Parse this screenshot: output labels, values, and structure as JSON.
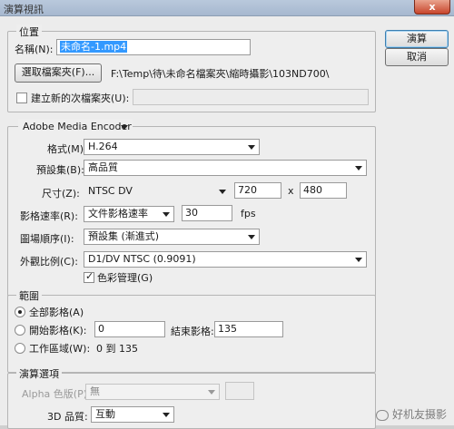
{
  "window": {
    "title": "演算視訊",
    "close_glyph": "x"
  },
  "buttons": {
    "render": "演算",
    "cancel": "取消"
  },
  "location": {
    "legend": "位置",
    "name_label": "名稱(N):",
    "name_value": "未命名-1.mp4",
    "select_folder": "選取檔案夾(F)...",
    "folder_path": "F:\\Temp\\待\\未命名檔案夾\\縮時攝影\\103ND700\\",
    "create_subfolder": "建立新的次檔案夾(U):",
    "subfolder_value": ""
  },
  "encoder": {
    "selector": "Adobe Media Encoder",
    "format_label": "格式(M):",
    "format_value": "H.264",
    "preset_label": "預設集(B):",
    "preset_value": "高品質",
    "size_label": "尺寸(Z):",
    "size_value": "NTSC DV",
    "width": "720",
    "x": "x",
    "height": "480",
    "framerate_label": "影格速率(R):",
    "framerate_value": "文件影格速率",
    "fps_value": "30",
    "fps_unit": "fps",
    "field_order_label": "圖場順序(I):",
    "field_order_value": "預設集 (漸進式)",
    "aspect_label": "外觀比例(C):",
    "aspect_value": "D1/DV NTSC (0.9091)",
    "color_mgmt": "色彩管理(G)"
  },
  "range": {
    "legend": "範圍",
    "all_frames": "全部影格(A)",
    "start_frame": "開始影格(K):",
    "start_value": "0",
    "end_label": "結束影格:",
    "end_value": "135",
    "work_area": "工作區域(W):",
    "work_area_value": "0 到 135"
  },
  "render_options": {
    "legend": "演算選項",
    "alpha_label": "Alpha 色版(P):",
    "alpha_value": "無",
    "quality_label": "3D 品質:",
    "quality_value": "互動"
  },
  "watermark": "好机友摄影"
}
